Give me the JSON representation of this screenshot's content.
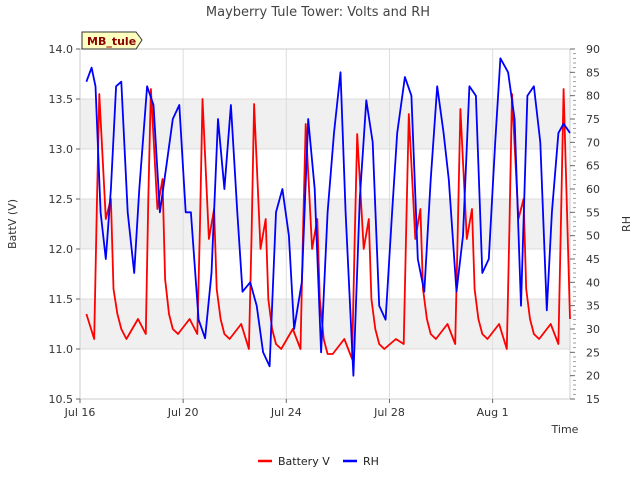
{
  "chart_data": {
    "type": "line",
    "title": "Mayberry Tule Tower: Volts and RH",
    "station_label": "MB_tule",
    "xlabel": "Time",
    "ylabel_left": "BattV (V)",
    "ylabel_right": "RH",
    "x_ticks": [
      "Jul 16",
      "Jul 20",
      "Jul 24",
      "Jul 28",
      "Aug 1"
    ],
    "y_left_ticks": [
      "10.5",
      "11.0",
      "11.5",
      "12.0",
      "12.5",
      "13.0",
      "13.5",
      "14.0"
    ],
    "y_right_ticks": [
      "15",
      "20",
      "25",
      "30",
      "35",
      "40",
      "45",
      "50",
      "55",
      "60",
      "65",
      "70",
      "75",
      "80",
      "85",
      "90"
    ],
    "xlim_days": [
      0,
      19
    ],
    "ylim_left": [
      10.5,
      14.0
    ],
    "ylim_right": [
      15,
      90
    ],
    "legend_position": "bottom-center",
    "colors": {
      "battery": "#ff0000",
      "rh": "#0000ff",
      "band": "#f0f0f0",
      "grid": "#dddddd",
      "badge_bg": "#ffffc0"
    },
    "series": [
      {
        "name": "Battery V",
        "axis": "left",
        "color": "#ff0000",
        "x_days": [
          0.25,
          0.55,
          0.65,
          0.75,
          1.0,
          1.2,
          1.3,
          1.45,
          1.6,
          1.8,
          2.25,
          2.55,
          2.65,
          2.75,
          3.0,
          3.2,
          3.3,
          3.45,
          3.6,
          3.8,
          4.25,
          4.55,
          4.65,
          4.75,
          5.0,
          5.2,
          5.3,
          5.45,
          5.6,
          5.8,
          6.25,
          6.55,
          6.65,
          6.75,
          7.0,
          7.2,
          7.3,
          7.45,
          7.6,
          7.8,
          8.25,
          8.55,
          8.65,
          8.75,
          9.0,
          9.2,
          9.3,
          9.45,
          9.6,
          9.8,
          10.25,
          10.55,
          10.65,
          10.75,
          11.0,
          11.2,
          11.3,
          11.45,
          11.6,
          11.8,
          12.25,
          12.55,
          12.65,
          12.75,
          13.0,
          13.2,
          13.3,
          13.45,
          13.6,
          13.8,
          14.25,
          14.55,
          14.65,
          14.75,
          15.0,
          15.2,
          15.3,
          15.45,
          15.6,
          15.8,
          16.25,
          16.55,
          16.65,
          16.75,
          17.0,
          17.2,
          17.3,
          17.45,
          17.6,
          17.8,
          18.25,
          18.55,
          18.65,
          18.75,
          19.0
        ],
        "values": [
          11.35,
          11.1,
          12.4,
          13.55,
          12.3,
          12.5,
          11.6,
          11.35,
          11.2,
          11.1,
          11.3,
          11.15,
          12.5,
          13.6,
          12.4,
          12.7,
          11.7,
          11.35,
          11.2,
          11.15,
          11.3,
          11.15,
          12.2,
          13.5,
          12.1,
          12.4,
          11.6,
          11.3,
          11.15,
          11.1,
          11.25,
          11.0,
          12.1,
          13.45,
          12.0,
          12.3,
          11.5,
          11.2,
          11.05,
          11.0,
          11.2,
          11.0,
          12.2,
          13.25,
          12.0,
          12.3,
          11.5,
          11.1,
          10.95,
          10.95,
          11.1,
          10.9,
          12.1,
          13.15,
          12.0,
          12.3,
          11.5,
          11.2,
          11.05,
          11.0,
          11.1,
          11.05,
          12.2,
          13.35,
          12.1,
          12.4,
          11.6,
          11.3,
          11.15,
          11.1,
          11.25,
          11.05,
          12.2,
          13.4,
          12.1,
          12.4,
          11.6,
          11.3,
          11.15,
          11.1,
          11.25,
          11.0,
          12.2,
          13.55,
          12.3,
          12.5,
          11.6,
          11.3,
          11.15,
          11.1,
          11.25,
          11.05,
          12.3,
          13.6,
          11.3
        ]
      },
      {
        "name": "RH",
        "axis": "right",
        "color": "#0000ff",
        "x_days": [
          0.25,
          0.45,
          0.6,
          0.8,
          1.0,
          1.2,
          1.4,
          1.6,
          1.85,
          2.1,
          2.3,
          2.6,
          2.85,
          3.1,
          3.35,
          3.6,
          3.85,
          4.1,
          4.3,
          4.6,
          4.85,
          5.1,
          5.35,
          5.6,
          5.85,
          6.1,
          6.3,
          6.6,
          6.85,
          7.1,
          7.35,
          7.6,
          7.85,
          8.1,
          8.3,
          8.6,
          8.85,
          9.1,
          9.35,
          9.6,
          9.85,
          10.1,
          10.3,
          10.6,
          10.85,
          11.1,
          11.35,
          11.6,
          11.85,
          12.1,
          12.3,
          12.6,
          12.85,
          13.1,
          13.35,
          13.6,
          13.85,
          14.1,
          14.3,
          14.6,
          14.85,
          15.1,
          15.35,
          15.6,
          15.85,
          16.1,
          16.3,
          16.6,
          16.85,
          17.1,
          17.35,
          17.6,
          17.85,
          18.1,
          18.3,
          18.55,
          18.75,
          19.0
        ],
        "values": [
          83,
          86,
          82,
          55,
          45,
          60,
          82,
          83,
          55,
          42,
          60,
          82,
          78,
          55,
          65,
          75,
          78,
          55,
          55,
          32,
          28,
          42,
          75,
          60,
          78,
          55,
          38,
          40,
          35,
          25,
          22,
          55,
          60,
          50,
          30,
          40,
          75,
          60,
          25,
          55,
          72,
          85,
          55,
          20,
          58,
          79,
          70,
          35,
          32,
          55,
          72,
          84,
          80,
          45,
          38,
          62,
          82,
          72,
          62,
          38,
          50,
          82,
          80,
          42,
          45,
          70,
          88,
          85,
          75,
          35,
          80,
          82,
          70,
          34,
          55,
          72,
          74,
          72
        ]
      }
    ]
  }
}
